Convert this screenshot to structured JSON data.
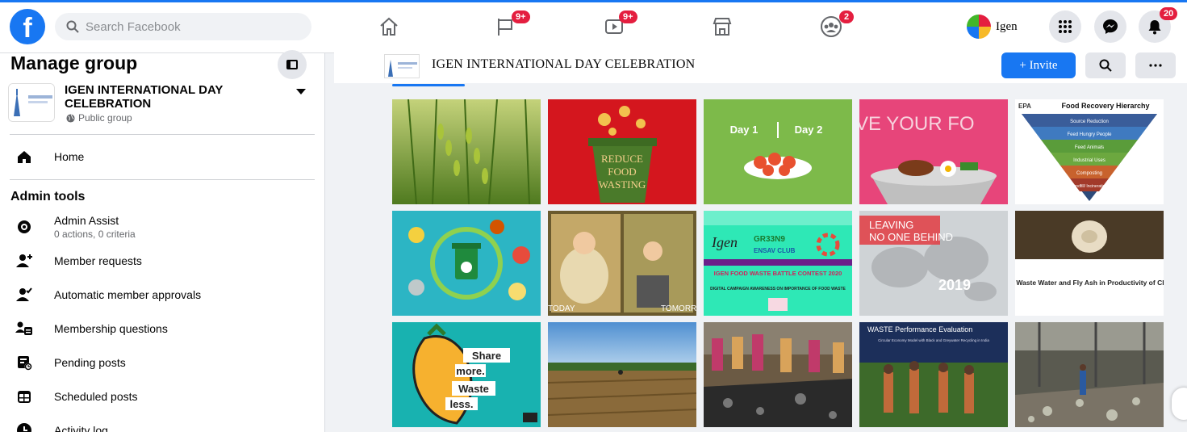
{
  "search": {
    "placeholder": "Search Facebook"
  },
  "nav": {
    "pages_badge": "9+",
    "watch_badge": "9+",
    "groups_badge": "2",
    "notifications_badge": "20",
    "profile_name": "Igen"
  },
  "sidebar": {
    "title": "Manage group",
    "group_name": "IGEN INTERNATIONAL DAY CELEBRATION",
    "group_type": "Public group",
    "home_label": "Home",
    "admin_tools_heading": "Admin tools",
    "items": [
      {
        "label": "Admin Assist",
        "sub": "0 actions, 0 criteria"
      },
      {
        "label": "Member requests"
      },
      {
        "label": "Automatic member approvals"
      },
      {
        "label": "Membership questions"
      },
      {
        "label": "Pending posts"
      },
      {
        "label": "Scheduled posts"
      },
      {
        "label": "Activity log"
      }
    ]
  },
  "main": {
    "group_title": "IGEN INTERNATIONAL DAY CELEBRATION",
    "invite_label": "+ Invite",
    "photos": [
      {
        "alt": "Rice paddy field",
        "texts": []
      },
      {
        "alt": "Reduce food wasting bin illustration",
        "texts": [
          "REDUCE",
          "FOOD",
          "WASTING"
        ]
      },
      {
        "alt": "Day 1 Day 2 food plates",
        "texts": [
          "Day 1",
          "Day 2"
        ]
      },
      {
        "alt": "Love your food",
        "texts": [
          "VE YOUR FO"
        ]
      },
      {
        "alt": "EPA Food Recovery Hierarchy",
        "texts": [
          "Food Recovery Hierarchy",
          "Source Reduction",
          "Feed Hungry People",
          "Feed Animals",
          "Industrial Uses",
          "Composting",
          "Landfill/ Incineration"
        ]
      },
      {
        "alt": "Recycling bin with food icons",
        "texts": []
      },
      {
        "alt": "Today Tomorrow cartoon",
        "texts": [
          "TODAY",
          "TOMORR"
        ]
      },
      {
        "alt": "IGEN food waste battle contest poster",
        "texts": [
          "IGEN FOOD WASTE BATTLE CONTEST 2020",
          "DIGITAL CAMPAIGN AWARENESS ON IMPORTANCE OF FOOD WASTE",
          "GR33N9",
          "ENSAV CLUB"
        ]
      },
      {
        "alt": "Leaving no one behind WWDR 2019",
        "texts": [
          "LEAVING",
          "NO ONE BEHIND",
          "2019"
        ]
      },
      {
        "alt": "Role of waste water and fly ash",
        "texts": [
          "Role of Waste Water and Fly Ash in Productivity of Chickpea"
        ]
      },
      {
        "alt": "Share more waste less pepper",
        "texts": [
          "Share",
          "more.",
          "Waste",
          "less."
        ]
      },
      {
        "alt": "Harvested farm field",
        "texts": []
      },
      {
        "alt": "People at a polluted drain",
        "texts": []
      },
      {
        "alt": "Waste performance evaluation",
        "texts": [
          "WASTE Performance Evaluation",
          "Circular Economy Model with Black and Greywater Recycling in India"
        ]
      },
      {
        "alt": "Waste dump inside a shed",
        "texts": []
      }
    ]
  },
  "colors": {
    "accent": "#1877f2",
    "badge": "#e41e3f"
  }
}
